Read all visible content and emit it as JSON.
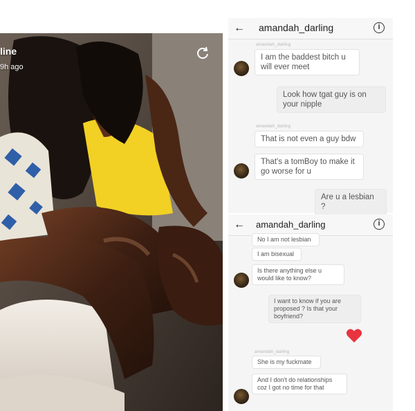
{
  "video": {
    "story_name": "line",
    "story_time": "9h ago",
    "refresh_icon": "refresh-icon"
  },
  "chat_top": {
    "username": "amandah_darling",
    "messages": [
      {
        "sender": "amandah_darling",
        "text": "I am the baddest bitch u will ever meet",
        "from": "them"
      },
      {
        "text": "Look how tgat guy is on your nipple",
        "from": "me"
      },
      {
        "sender": "amandah_darling",
        "text": "That is not even a guy bdw",
        "from": "them"
      },
      {
        "text": "That's a tomBoy to make it go worse for u",
        "from": "them"
      },
      {
        "text": "Are u a lesbian ?",
        "from": "me"
      }
    ]
  },
  "chat_bottom": {
    "username": "amandah_darling",
    "messages": [
      {
        "text": "No I am not lesbian",
        "from": "them"
      },
      {
        "text": "I am bisexual",
        "from": "them"
      },
      {
        "text": "Is there anything else u would like to know?",
        "from": "them"
      },
      {
        "text": "I want to know if you are proposed ? Is that your boyfriend?",
        "from": "me"
      },
      {
        "sender": "amandah_darling",
        "text": "She is my fuckmate",
        "from": "them"
      },
      {
        "text": "And I don't do relationships coz I got no time for that",
        "from": "them"
      }
    ],
    "reaction": "heart-icon"
  },
  "colors": {
    "heart": "#e8343e",
    "panel_bg": "#f5f5f5",
    "bubble_border": "#e2e2e2"
  }
}
